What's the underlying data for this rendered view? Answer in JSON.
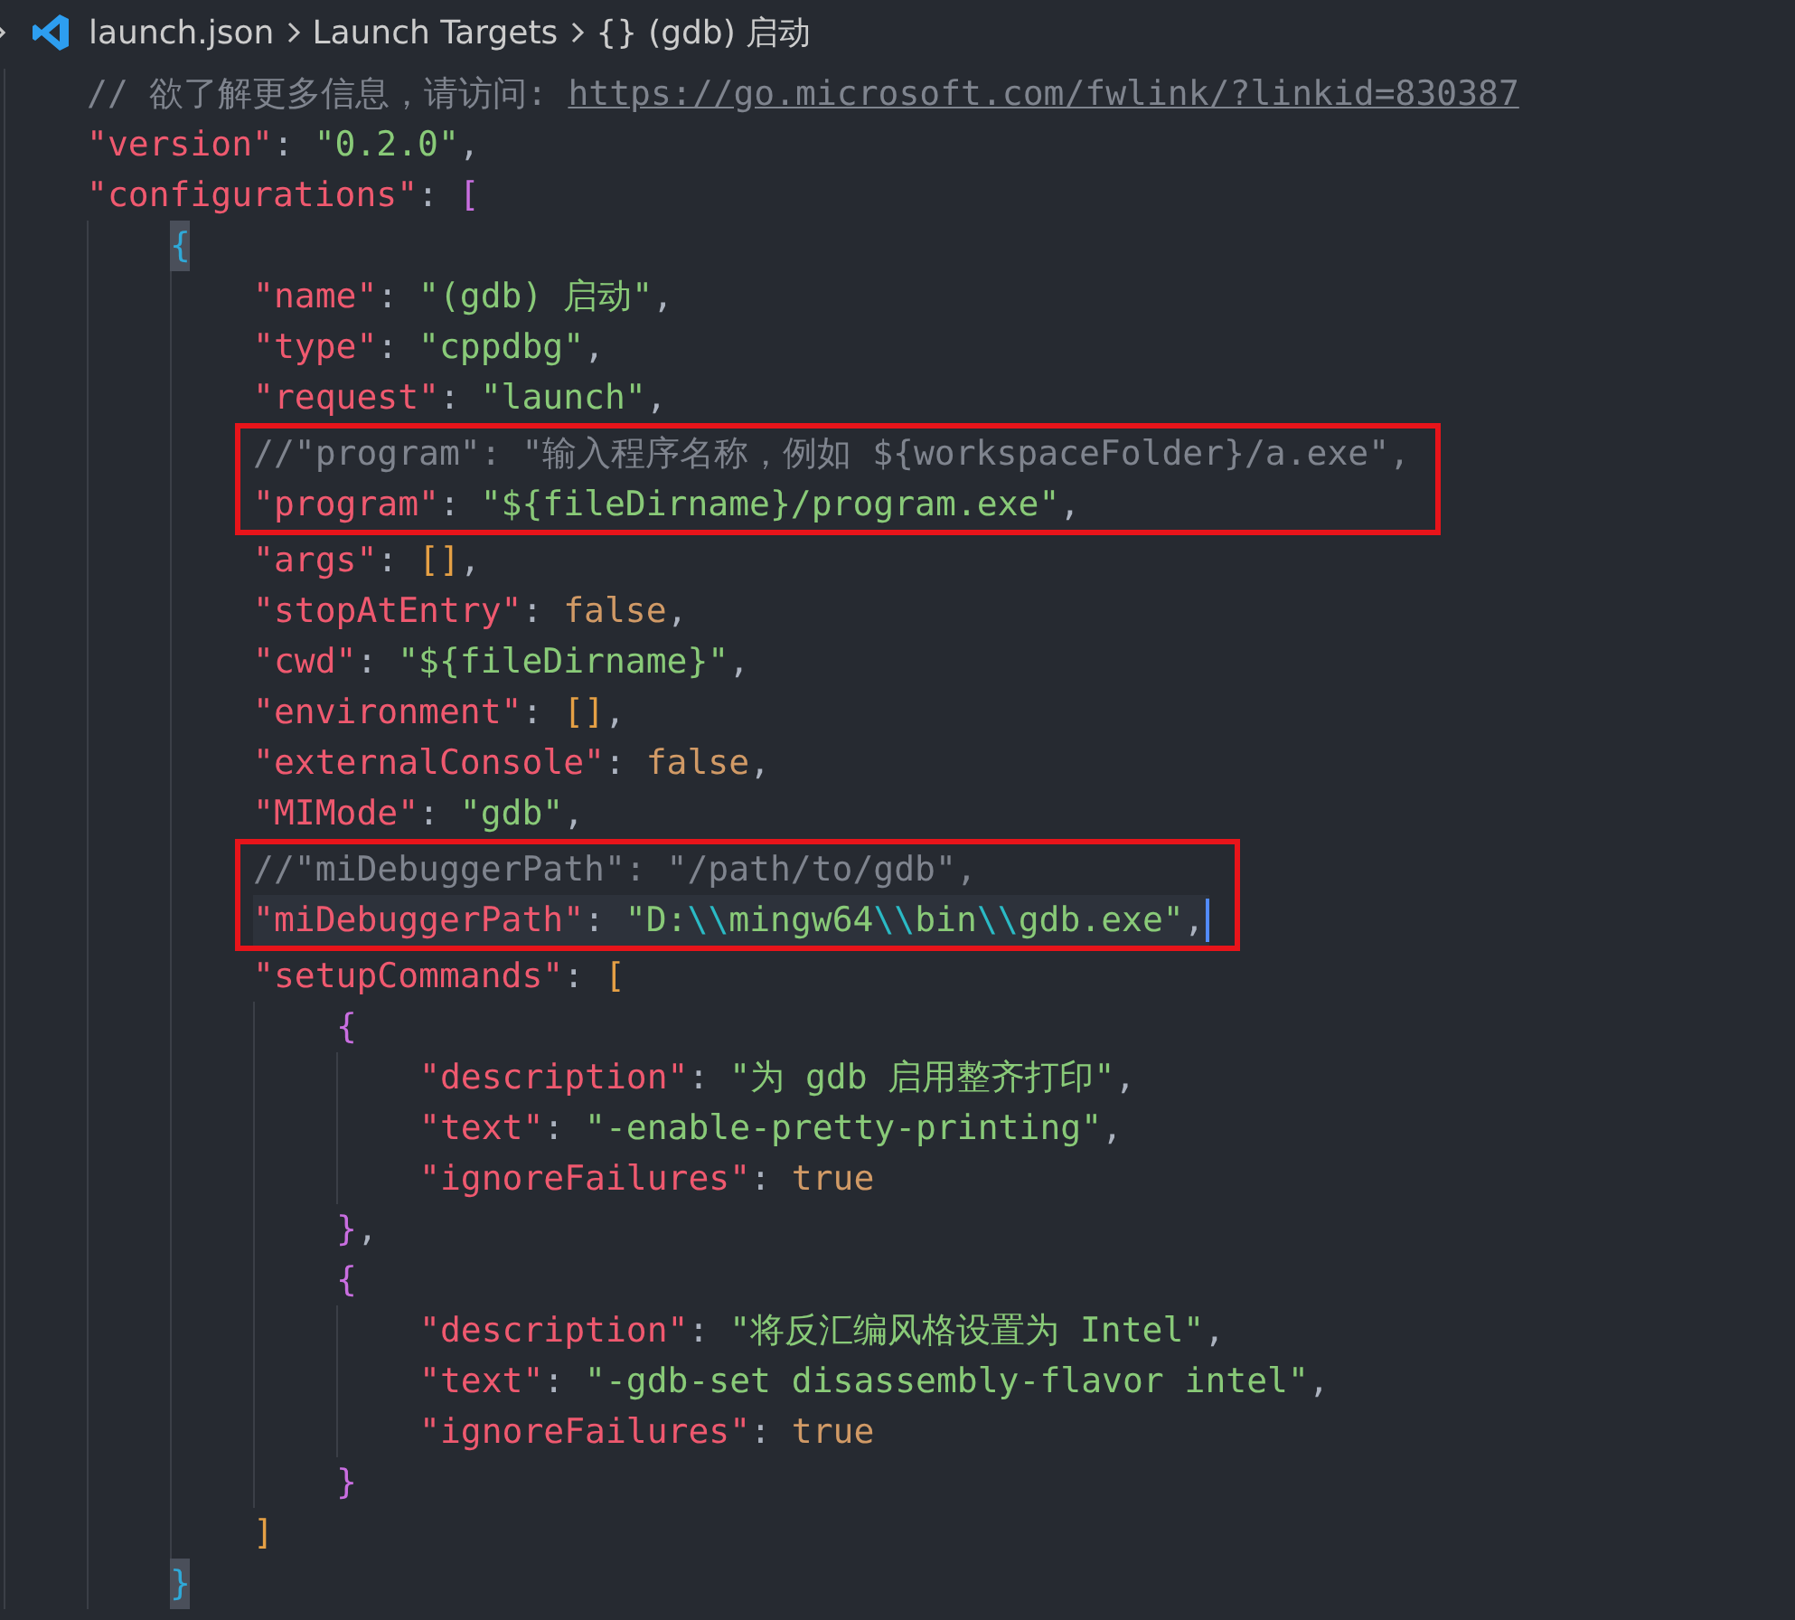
{
  "breadcrumb": [
    {
      "kind": "file",
      "label": "launch.json"
    },
    {
      "kind": "plain",
      "label": "Launch Targets"
    },
    {
      "kind": "symbol",
      "icon": "{}",
      "label": "(gdb) 启动"
    }
  ],
  "lines": [
    {
      "tokens": [
        {
          "kind": "comment",
          "text": "// 欲了解更多信息，请访问: "
        },
        {
          "kind": "link",
          "text": "https://go.microsoft.com/fwlink/?linkid=830387"
        }
      ]
    },
    {
      "tokens": [
        {
          "kind": "key",
          "text": "\"version\""
        },
        {
          "kind": "punct",
          "text": ": "
        },
        {
          "kind": "string",
          "text": "\"0.2.0\""
        },
        {
          "kind": "punct",
          "text": ","
        }
      ]
    },
    {
      "tokens": [
        {
          "kind": "key",
          "text": "\"configurations\""
        },
        {
          "kind": "punct",
          "text": ": "
        },
        {
          "kind": "bracket-2",
          "text": "["
        }
      ],
      "children": [
        {
          "tokens": [
            {
              "kind": "bracket-3",
              "text": "{",
              "matched": true
            }
          ],
          "children": [
            {
              "tokens": [
                {
                  "kind": "key",
                  "text": "\"name\""
                },
                {
                  "kind": "punct",
                  "text": ": "
                },
                {
                  "kind": "string",
                  "text": "\"(gdb) 启动\""
                },
                {
                  "kind": "punct",
                  "text": ","
                }
              ]
            },
            {
              "tokens": [
                {
                  "kind": "key",
                  "text": "\"type\""
                },
                {
                  "kind": "punct",
                  "text": ": "
                },
                {
                  "kind": "string",
                  "text": "\"cppdbg\""
                },
                {
                  "kind": "punct",
                  "text": ","
                }
              ]
            },
            {
              "tokens": [
                {
                  "kind": "key",
                  "text": "\"request\""
                },
                {
                  "kind": "punct",
                  "text": ": "
                },
                {
                  "kind": "string",
                  "text": "\"launch\""
                },
                {
                  "kind": "punct",
                  "text": ","
                }
              ]
            },
            {
              "boxed": true,
              "tokens": [
                {
                  "kind": "comment",
                  "text": "//\"program\": \"输入程序名称，例如 ${workspaceFolder}/a.exe\","
                }
              ]
            },
            {
              "boxed": true,
              "tokens": [
                {
                  "kind": "key",
                  "text": "\"program\""
                },
                {
                  "kind": "punct",
                  "text": ": "
                },
                {
                  "kind": "string",
                  "text": "\"${fileDirname}/program.exe\""
                },
                {
                  "kind": "punct",
                  "text": ","
                }
              ]
            },
            {
              "tokens": [
                {
                  "kind": "key",
                  "text": "\"args\""
                },
                {
                  "kind": "punct",
                  "text": ": "
                },
                {
                  "kind": "bracket-1",
                  "text": "[]"
                },
                {
                  "kind": "punct",
                  "text": ","
                }
              ]
            },
            {
              "tokens": [
                {
                  "kind": "key",
                  "text": "\"stopAtEntry\""
                },
                {
                  "kind": "punct",
                  "text": ": "
                },
                {
                  "kind": "literal",
                  "text": "false"
                },
                {
                  "kind": "punct",
                  "text": ","
                }
              ]
            },
            {
              "tokens": [
                {
                  "kind": "key",
                  "text": "\"cwd\""
                },
                {
                  "kind": "punct",
                  "text": ": "
                },
                {
                  "kind": "string",
                  "text": "\"${fileDirname}\""
                },
                {
                  "kind": "punct",
                  "text": ","
                }
              ]
            },
            {
              "tokens": [
                {
                  "kind": "key",
                  "text": "\"environment\""
                },
                {
                  "kind": "punct",
                  "text": ": "
                },
                {
                  "kind": "bracket-1",
                  "text": "[]"
                },
                {
                  "kind": "punct",
                  "text": ","
                }
              ]
            },
            {
              "tokens": [
                {
                  "kind": "key",
                  "text": "\"externalConsole\""
                },
                {
                  "kind": "punct",
                  "text": ": "
                },
                {
                  "kind": "literal",
                  "text": "false"
                },
                {
                  "kind": "punct",
                  "text": ","
                }
              ]
            },
            {
              "tokens": [
                {
                  "kind": "key",
                  "text": "\"MIMode\""
                },
                {
                  "kind": "punct",
                  "text": ": "
                },
                {
                  "kind": "string",
                  "text": "\"gdb\""
                },
                {
                  "kind": "punct",
                  "text": ","
                }
              ]
            },
            {
              "boxed": true,
              "tokens": [
                {
                  "kind": "comment",
                  "text": "//\"miDebuggerPath\": \"/path/to/gdb\","
                }
              ]
            },
            {
              "boxed": true,
              "current": true,
              "tokens": [
                {
                  "kind": "key",
                  "text": "\"miDebuggerPath\""
                },
                {
                  "kind": "punct",
                  "text": ": "
                },
                {
                  "kind": "string",
                  "text": "\"D:"
                },
                {
                  "kind": "escape",
                  "text": "\\\\"
                },
                {
                  "kind": "string",
                  "text": "mingw64"
                },
                {
                  "kind": "escape",
                  "text": "\\\\"
                },
                {
                  "kind": "string",
                  "text": "bin"
                },
                {
                  "kind": "escape",
                  "text": "\\\\"
                },
                {
                  "kind": "string",
                  "text": "gdb.exe\""
                },
                {
                  "kind": "punct",
                  "text": ","
                }
              ]
            },
            {
              "tokens": [
                {
                  "kind": "key",
                  "text": "\"setupCommands\""
                },
                {
                  "kind": "punct",
                  "text": ": "
                },
                {
                  "kind": "bracket-1",
                  "text": "["
                }
              ],
              "children": [
                {
                  "tokens": [
                    {
                      "kind": "bracket-2",
                      "text": "{"
                    }
                  ],
                  "children": [
                    {
                      "tokens": [
                        {
                          "kind": "key",
                          "text": "\"description\""
                        },
                        {
                          "kind": "punct",
                          "text": ": "
                        },
                        {
                          "kind": "string",
                          "text": "\"为 gdb 启用整齐打印\""
                        },
                        {
                          "kind": "punct",
                          "text": ","
                        }
                      ]
                    },
                    {
                      "tokens": [
                        {
                          "kind": "key",
                          "text": "\"text\""
                        },
                        {
                          "kind": "punct",
                          "text": ": "
                        },
                        {
                          "kind": "string",
                          "text": "\"-enable-pretty-printing\""
                        },
                        {
                          "kind": "punct",
                          "text": ","
                        }
                      ]
                    },
                    {
                      "tokens": [
                        {
                          "kind": "key",
                          "text": "\"ignoreFailures\""
                        },
                        {
                          "kind": "punct",
                          "text": ": "
                        },
                        {
                          "kind": "literal",
                          "text": "true"
                        }
                      ]
                    }
                  ]
                },
                {
                  "tokens": [
                    {
                      "kind": "bracket-2",
                      "text": "}"
                    },
                    {
                      "kind": "punct",
                      "text": ","
                    }
                  ]
                },
                {
                  "tokens": [
                    {
                      "kind": "bracket-2",
                      "text": "{"
                    }
                  ],
                  "children": [
                    {
                      "tokens": [
                        {
                          "kind": "key",
                          "text": "\"description\""
                        },
                        {
                          "kind": "punct",
                          "text": ": "
                        },
                        {
                          "kind": "string",
                          "text": "\"将反汇编风格设置为 Intel\""
                        },
                        {
                          "kind": "punct",
                          "text": ","
                        }
                      ]
                    },
                    {
                      "tokens": [
                        {
                          "kind": "key",
                          "text": "\"text\""
                        },
                        {
                          "kind": "punct",
                          "text": ": "
                        },
                        {
                          "kind": "string",
                          "text": "\"-gdb-set disassembly-flavor intel\""
                        },
                        {
                          "kind": "punct",
                          "text": ","
                        }
                      ]
                    },
                    {
                      "tokens": [
                        {
                          "kind": "key",
                          "text": "\"ignoreFailures\""
                        },
                        {
                          "kind": "punct",
                          "text": ": "
                        },
                        {
                          "kind": "literal",
                          "text": "true"
                        }
                      ]
                    }
                  ]
                },
                {
                  "tokens": [
                    {
                      "kind": "bracket-2",
                      "text": "}"
                    }
                  ]
                }
              ]
            },
            {
              "tokens": [
                {
                  "kind": "bracket-1",
                  "text": "]"
                }
              ]
            }
          ]
        },
        {
          "tokens": [
            {
              "kind": "bracket-3",
              "text": "}",
              "matched": true
            }
          ]
        }
      ]
    }
  ]
}
